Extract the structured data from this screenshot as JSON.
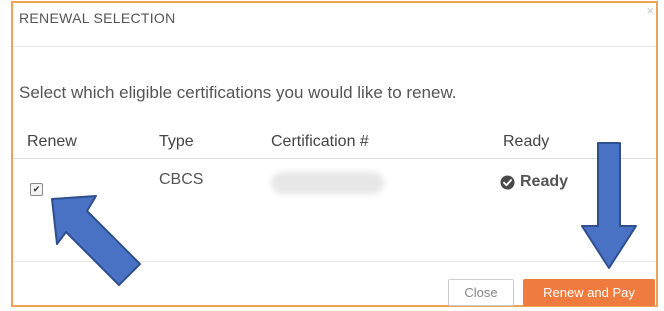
{
  "modal": {
    "title": "RENEWAL SELECTION",
    "close_glyph": "×",
    "prompt": "Select which eligible certifications you would like to renew."
  },
  "table": {
    "headers": [
      "Renew",
      "Type",
      "Certification #",
      "Ready"
    ],
    "rows": [
      {
        "renew_checked": true,
        "checkbox_glyph": "✔",
        "type": "CBCS",
        "certification_number": "",
        "ready": "Ready"
      }
    ]
  },
  "footer": {
    "close_label": "Close",
    "renew_label": "Renew and Pay"
  },
  "colors": {
    "accent": "#f07b3f",
    "frame_border": "#f0a25a",
    "arrow_fill": "#4a72c4",
    "arrow_stroke": "#2f4f8f"
  },
  "icons": {
    "ready": "check-circle-icon",
    "annotation_arrows": [
      "arrow-up-left-icon",
      "arrow-down-icon"
    ]
  }
}
